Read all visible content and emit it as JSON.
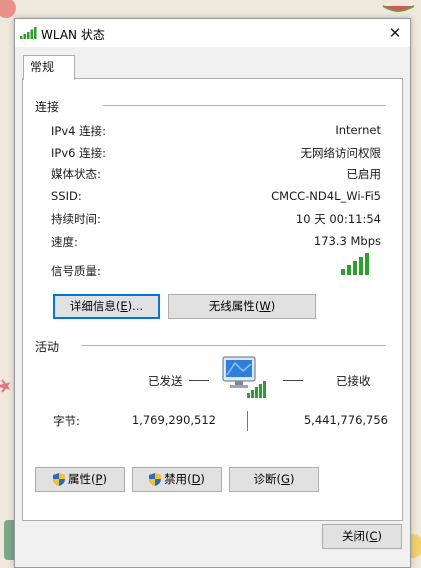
{
  "window": {
    "title": "WLAN 状态",
    "close_glyph": "✕"
  },
  "tabs": [
    {
      "label": "常规",
      "selected": true
    }
  ],
  "connection": {
    "group_label": "连接",
    "rows": [
      {
        "label": "IPv4 连接:",
        "value": "Internet"
      },
      {
        "label": "IPv6 连接:",
        "value": "无网络访问权限"
      },
      {
        "label": "媒体状态:",
        "value": "已启用"
      },
      {
        "label": "SSID:",
        "value": "CMCC-ND4L_Wi-Fi5"
      },
      {
        "label": "持续时间:",
        "value": "10 天 00:11:54"
      },
      {
        "label": "速度:",
        "value": "173.3 Mbps"
      }
    ],
    "signal_label": "信号质量:",
    "signal_bars": 5,
    "signal_bars_max": 5,
    "details_button": {
      "text": "详细信息",
      "accel": "E",
      "suffix": "..."
    },
    "wireless_props_button": {
      "text": "无线属性",
      "accel": "W",
      "suffix": ""
    }
  },
  "activity": {
    "group_label": "活动",
    "sent_label": "已发送",
    "received_label": "已接收",
    "bytes_label": "字节:",
    "bytes_sent": "1,769,290,512",
    "bytes_received": "5,441,776,756"
  },
  "actions": {
    "properties_button": {
      "text": "属性",
      "accel": "P"
    },
    "disable_button": {
      "text": "禁用",
      "accel": "D"
    },
    "diagnose_button": {
      "text": "诊断",
      "accel": "G"
    },
    "close_button": {
      "text": "关闭",
      "accel": "C"
    }
  },
  "colors": {
    "signal_green": "#2e9e2e",
    "focus_blue": "#0078d7",
    "monitor_blue": "#2f7fd8"
  },
  "icons": [
    "wifi-signal-icon",
    "close-icon",
    "network-computer-icon",
    "uac-shield-icon"
  ]
}
